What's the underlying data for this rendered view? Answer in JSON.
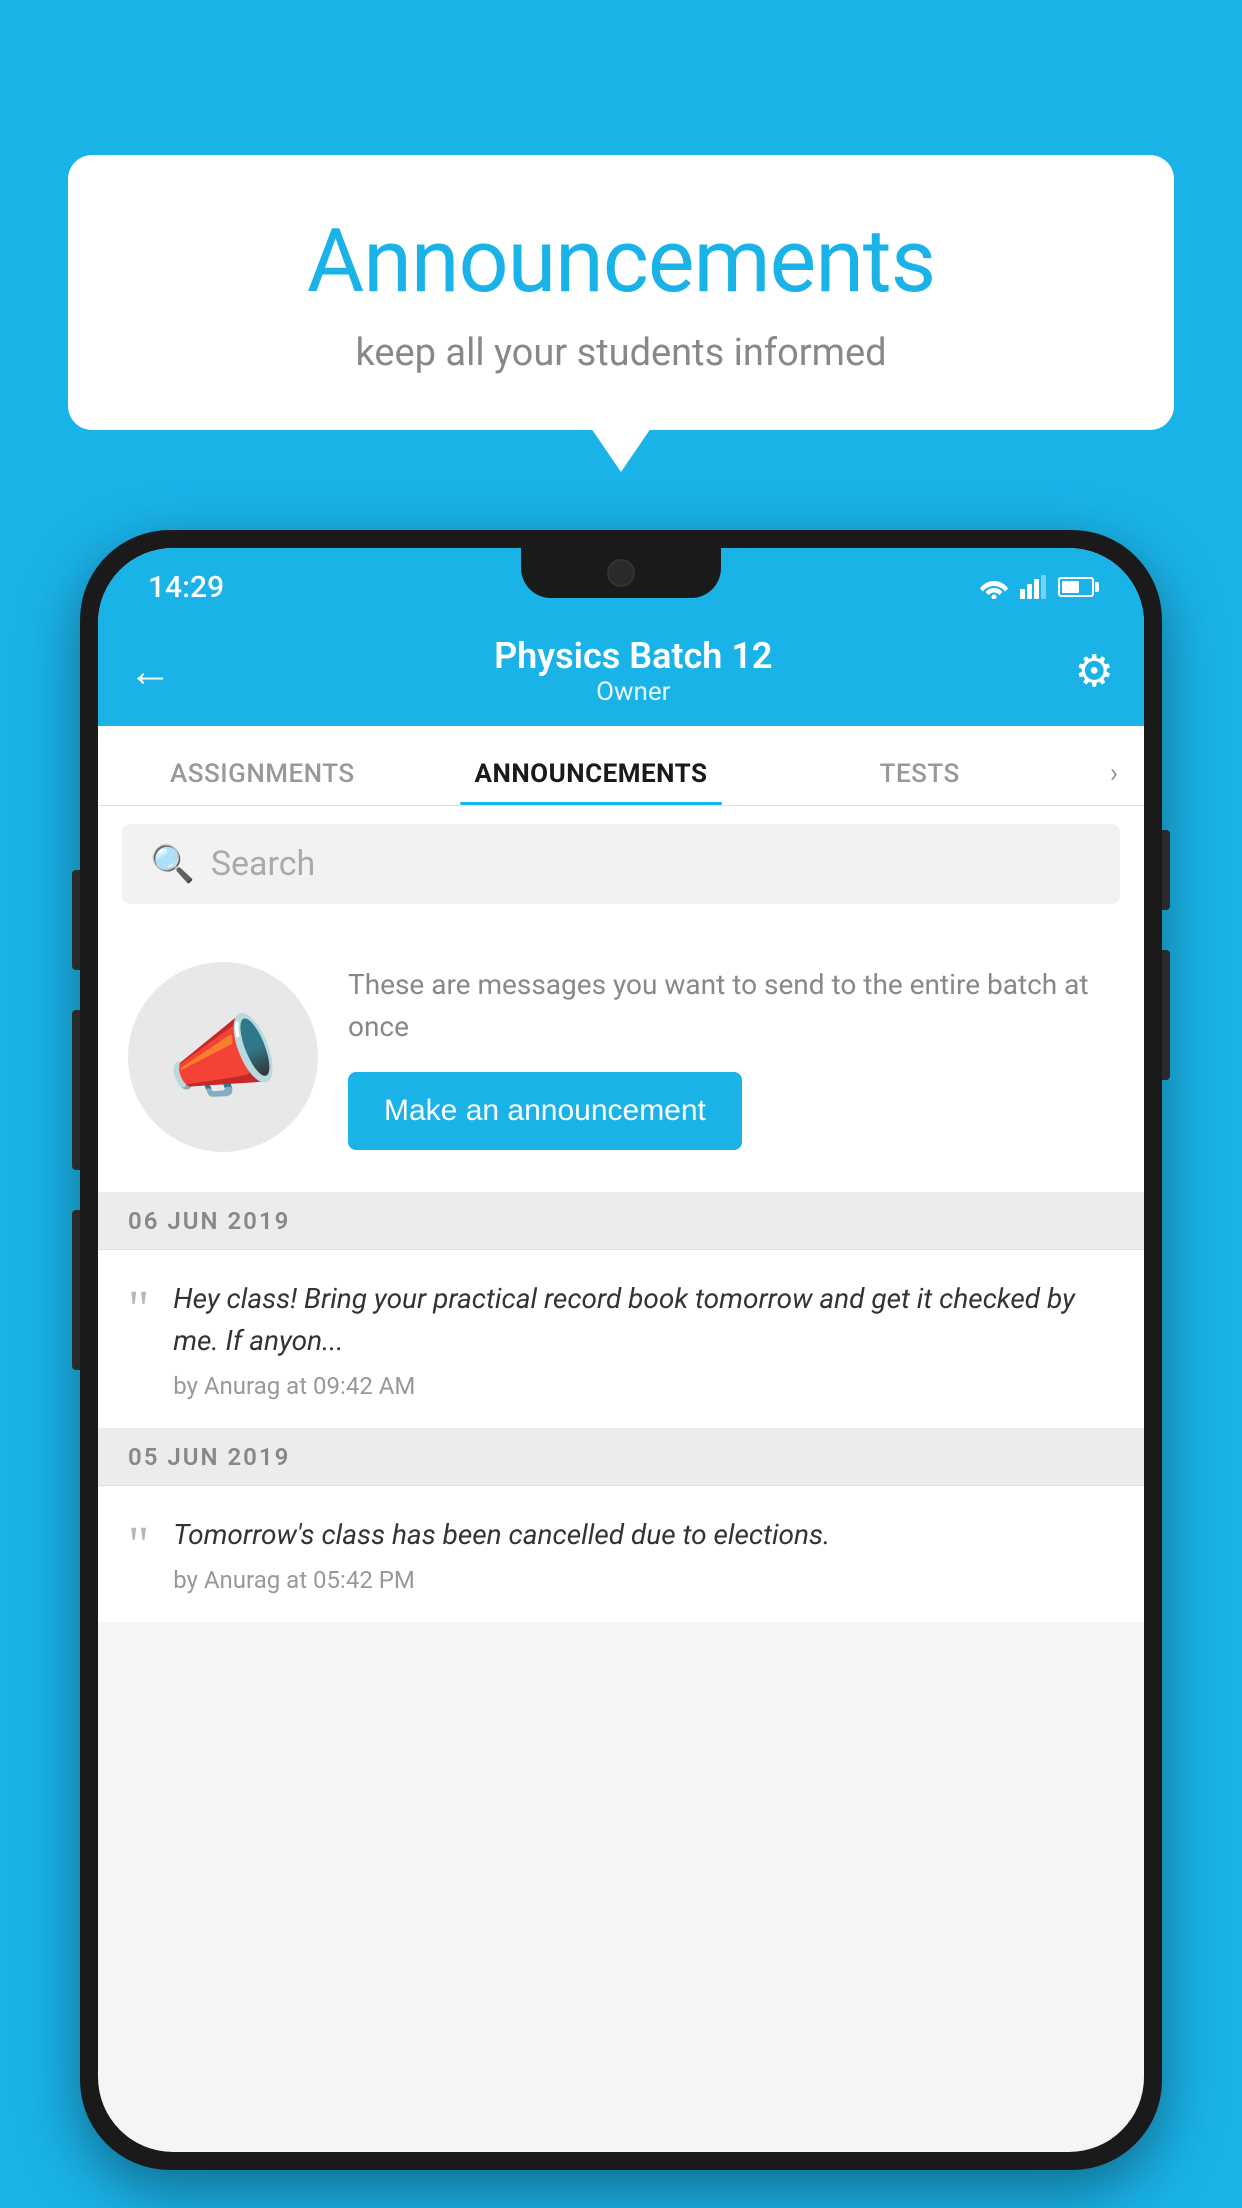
{
  "background_color": "#1ab3e8",
  "speech_bubble": {
    "title": "Announcements",
    "subtitle": "keep all your students informed"
  },
  "phone": {
    "status_bar": {
      "time": "14:29"
    },
    "app_bar": {
      "title": "Physics Batch 12",
      "subtitle": "Owner",
      "back_label": "←",
      "gear_label": "⚙"
    },
    "tabs": [
      {
        "label": "ASSIGNMENTS",
        "active": false
      },
      {
        "label": "ANNOUNCEMENTS",
        "active": true
      },
      {
        "label": "TESTS",
        "active": false
      }
    ],
    "tabs_more": "›",
    "search": {
      "placeholder": "Search"
    },
    "promo": {
      "text": "These are messages you want to send to the entire batch at once",
      "button_label": "Make an announcement"
    },
    "announcements": [
      {
        "date": "06  JUN  2019",
        "text": "Hey class! Bring your practical record book tomorrow and get it checked by me. If anyon...",
        "meta": "by Anurag at 09:42 AM"
      },
      {
        "date": "05  JUN  2019",
        "text": "Tomorrow's class has been cancelled due to elections.",
        "meta": "by Anurag at 05:42 PM"
      }
    ]
  }
}
